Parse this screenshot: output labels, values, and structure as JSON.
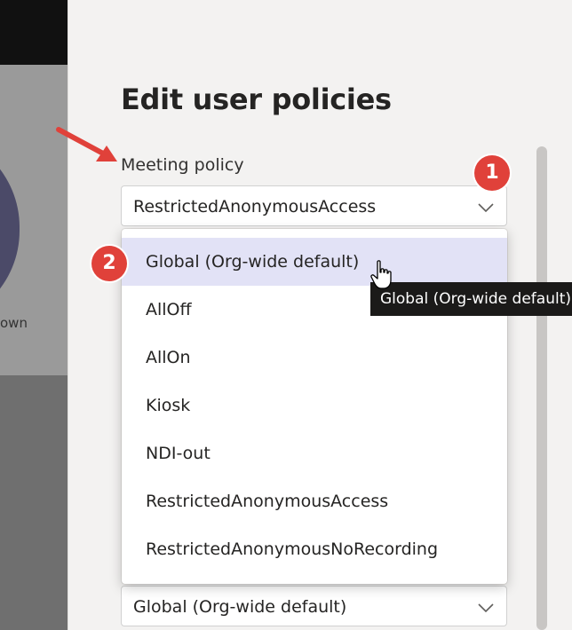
{
  "background_page": {
    "partial_text": "own"
  },
  "panel": {
    "title": "Edit user policies",
    "meeting_policy": {
      "label": "Meeting policy",
      "value": "RestrictedAnonymousAccess"
    },
    "bottom_field": {
      "value": "Global (Org-wide default)"
    }
  },
  "dropdown": {
    "selected_index": 0,
    "items": [
      {
        "label": "Global (Org-wide default)"
      },
      {
        "label": "AllOff"
      },
      {
        "label": "AllOn"
      },
      {
        "label": "Kiosk"
      },
      {
        "label": "NDI-out"
      },
      {
        "label": "RestrictedAnonymousAccess"
      },
      {
        "label": "RestrictedAnonymousNoRecording"
      }
    ]
  },
  "tooltip": {
    "text": "Global (Org-wide default)"
  },
  "annotations": {
    "badge_1": "1",
    "badge_2": "2",
    "color": "#e0413a"
  },
  "colors": {
    "panel_bg": "#f3f2f1",
    "selected_item_bg": "#e2e2f6",
    "tooltip_bg": "#1b1a19"
  }
}
